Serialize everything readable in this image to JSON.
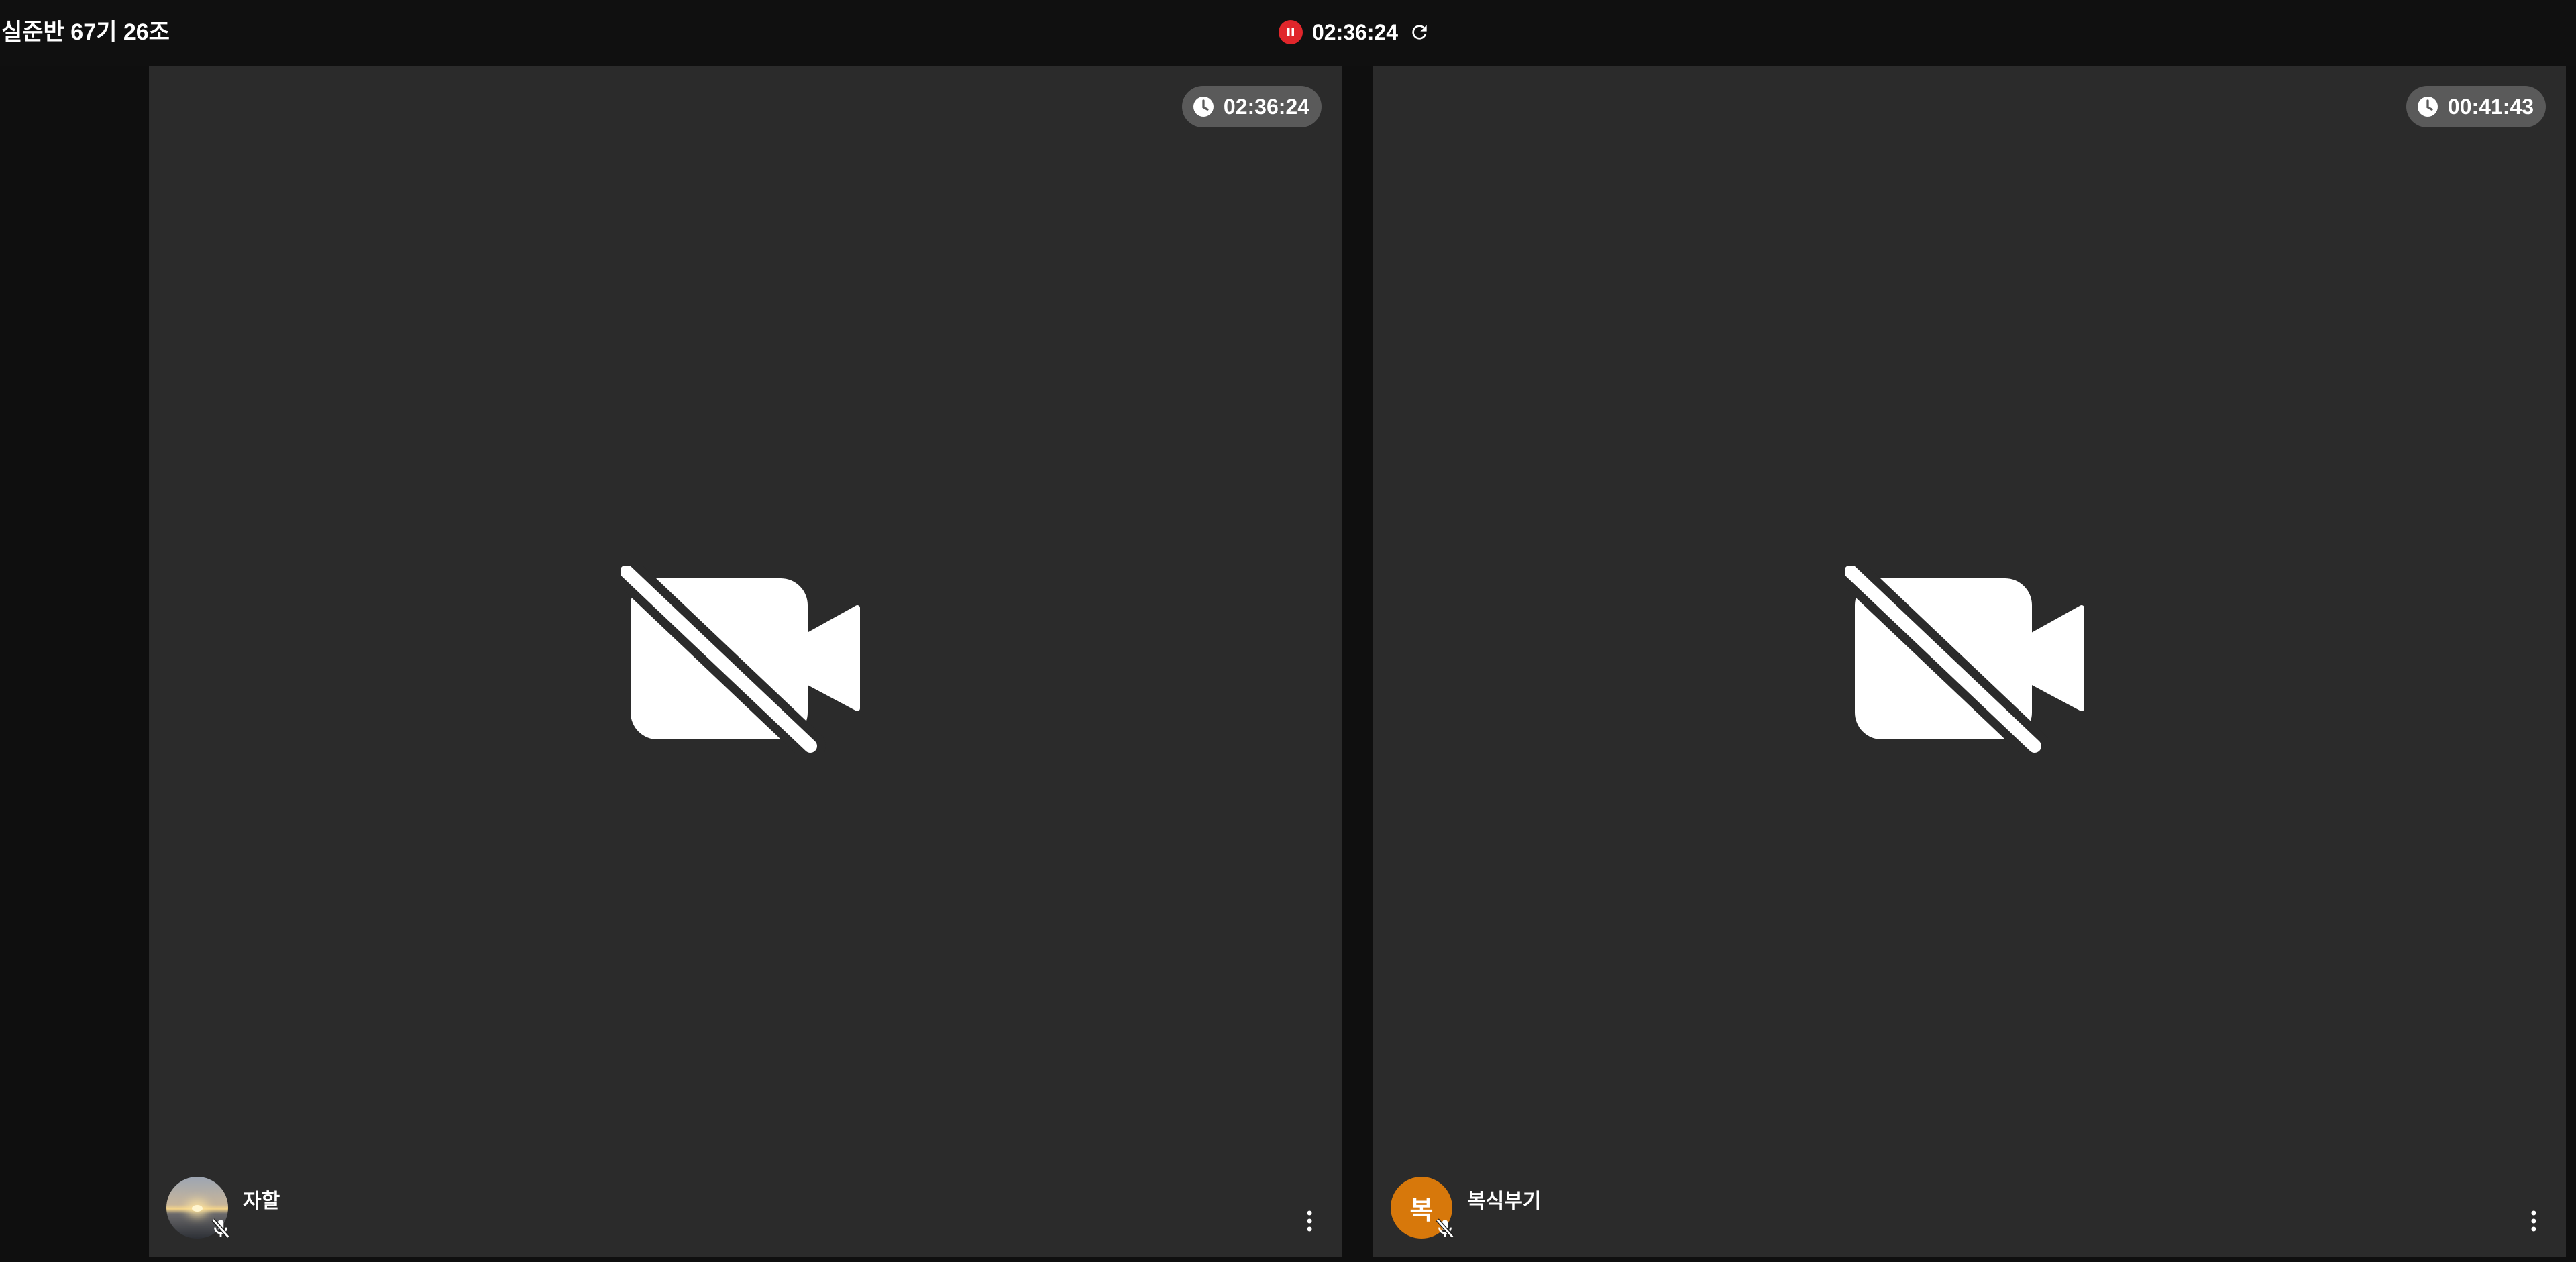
{
  "room": {
    "title": "실준반 67기 26조"
  },
  "recording": {
    "time": "02:36:24",
    "pause_icon": "pause-icon",
    "refresh_icon": "refresh-icon",
    "accent": "#e0262b"
  },
  "tiles": [
    {
      "timer": "02:36:24",
      "name": "자할",
      "avatar_type": "photo",
      "avatar_initial": "",
      "mic_status": "muted",
      "video_status": "off"
    },
    {
      "timer": "00:41:43",
      "name": "복식부기",
      "avatar_type": "initial",
      "avatar_initial": "복",
      "avatar_color": "#d7780b",
      "mic_status": "muted",
      "video_status": "off"
    }
  ],
  "colors": {
    "background": "#0f0f0f",
    "tile": "#2b2b2b",
    "badge": "#5a5a5a"
  }
}
